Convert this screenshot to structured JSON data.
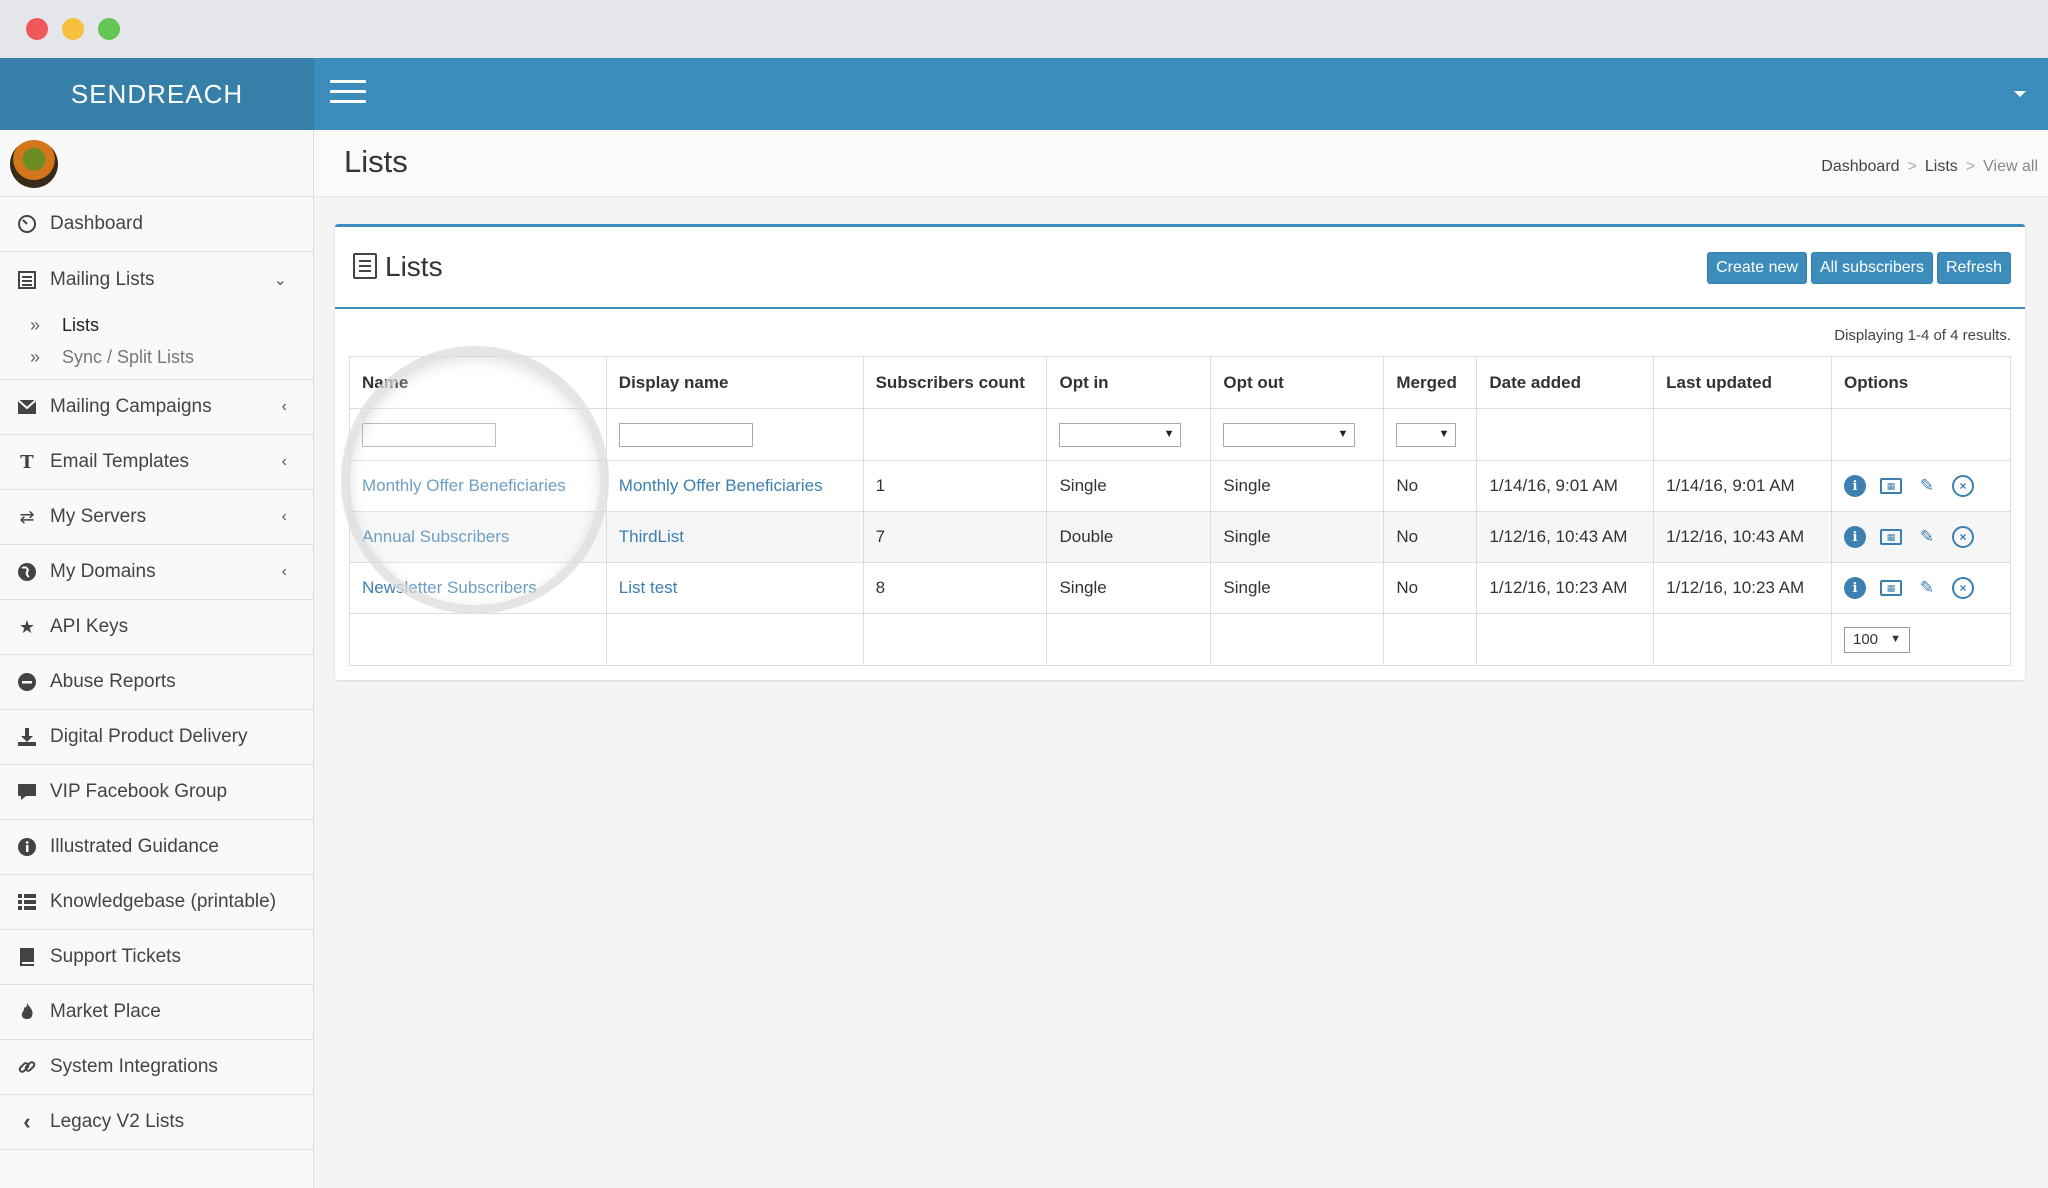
{
  "app": {
    "brand": "SENDREACH"
  },
  "sidebar": {
    "items": [
      {
        "label": "Dashboard",
        "icon": "dashboard-icon"
      },
      {
        "label": "Mailing Lists",
        "icon": "list-icon",
        "expanded": true,
        "children": [
          {
            "label": "Lists",
            "active": true
          },
          {
            "label": "Sync / Split Lists"
          }
        ]
      },
      {
        "label": "Mailing Campaigns",
        "icon": "envelope-icon"
      },
      {
        "label": "Email Templates",
        "icon": "text-icon"
      },
      {
        "label": "My Servers",
        "icon": "exchange-icon"
      },
      {
        "label": "My Domains",
        "icon": "globe-icon"
      },
      {
        "label": "API Keys",
        "icon": "star-icon"
      },
      {
        "label": "Abuse Reports",
        "icon": "minus-circle-icon"
      },
      {
        "label": "Digital Product Delivery",
        "icon": "download-icon"
      },
      {
        "label": "VIP Facebook Group",
        "icon": "comment-icon"
      },
      {
        "label": "Illustrated Guidance",
        "icon": "info-circle-icon"
      },
      {
        "label": "Knowledgebase (printable)",
        "icon": "th-list-icon"
      },
      {
        "label": "Support Tickets",
        "icon": "book-icon"
      },
      {
        "label": "Market Place",
        "icon": "fire-icon"
      },
      {
        "label": "System Integrations",
        "icon": "link-icon"
      },
      {
        "label": "Legacy V2 Lists",
        "icon": "chevron-left-icon"
      }
    ]
  },
  "header": {
    "title": "Lists",
    "breadcrumb": [
      "Dashboard",
      "Lists",
      "View all"
    ],
    "separator": ">"
  },
  "box": {
    "title": "Lists",
    "buttons": {
      "create": "Create new",
      "subscribers": "All subscribers",
      "refresh": "Refresh"
    },
    "summary": "Displaying 1-4 of 4 results."
  },
  "table": {
    "columns": [
      "Name",
      "Display name",
      "Subscribers count",
      "Opt in",
      "Opt out",
      "Merged",
      "Date added",
      "Last updated",
      "Options"
    ],
    "rows": [
      {
        "name": "Monthly Offer Beneficiaries",
        "display": "Monthly Offer Beneficiaries",
        "count": "1",
        "optin": "Single",
        "optout": "Single",
        "merged": "No",
        "added": "1/14/16, 9:01 AM",
        "updated": "1/14/16, 9:01 AM"
      },
      {
        "name": "Annual Subscribers",
        "display": "ThirdList",
        "count": "7",
        "optin": "Double",
        "optout": "Single",
        "merged": "No",
        "added": "1/12/16, 10:43 AM",
        "updated": "1/12/16, 10:43 AM"
      },
      {
        "name": "Newsletter Subscribers",
        "display": "List test",
        "count": "8",
        "optin": "Single",
        "optout": "Single",
        "merged": "No",
        "added": "1/12/16, 10:23 AM",
        "updated": "1/12/16, 10:23 AM"
      }
    ],
    "page_size": "100"
  },
  "colors": {
    "navbar": "#3c8dbc",
    "logo_bar": "#367fa9",
    "link": "#3c7fb1"
  }
}
